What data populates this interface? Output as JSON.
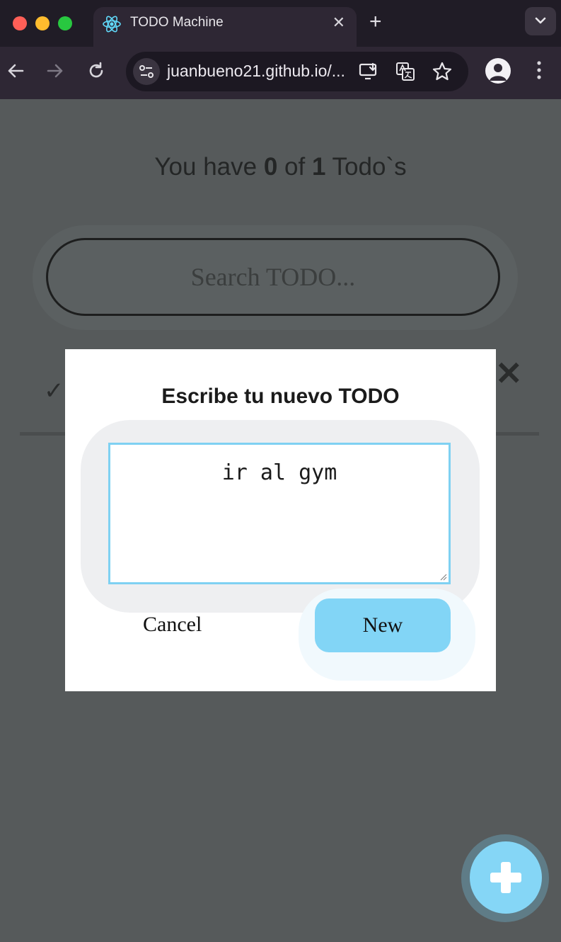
{
  "browser": {
    "tab": {
      "title": "TODO Machine",
      "close_symbol": "✕"
    },
    "new_tab_symbol": "+",
    "url": "juanbueno21.github.io/...",
    "colors": {
      "frame": "#201c26",
      "toolbar": "#2e2734",
      "omnibox": "#1c1822"
    }
  },
  "app": {
    "counter": {
      "prefix": "You have ",
      "completed": "0",
      "middle": " of ",
      "total": "1",
      "suffix": " Todo`s"
    },
    "search": {
      "placeholder": "Search TODO..."
    },
    "todo_item": {
      "check_symbol": "✓",
      "delete_symbol": "✕"
    },
    "modal": {
      "title": "Escribe tu nuevo TODO",
      "textarea_value": "ir al gym",
      "cancel_label": "Cancel",
      "submit_label": "New"
    },
    "colors": {
      "overlay": "#565a5b",
      "accent": "#82d5f6",
      "textarea_border": "#7fd1f2"
    }
  }
}
